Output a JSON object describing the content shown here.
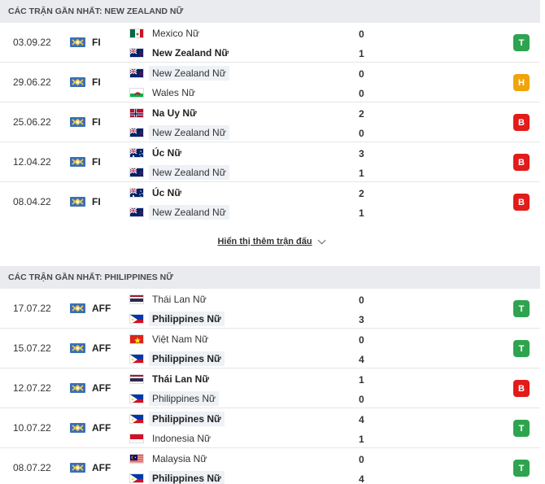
{
  "sections": [
    {
      "title": "CÁC TRẬN GẦN NHẤT: NEW ZEALAND NỮ",
      "matches": [
        {
          "date": "03.09.22",
          "league": "FI",
          "home": {
            "name": "Mexico Nữ",
            "flag": "mx",
            "bold": false,
            "hl": false
          },
          "home_score": "0",
          "away": {
            "name": "New Zealand Nữ",
            "flag": "nz",
            "bold": true,
            "hl": false
          },
          "away_score": "1",
          "result": "T",
          "result_color": "#2ea44f"
        },
        {
          "date": "29.06.22",
          "league": "FI",
          "home": {
            "name": "New Zealand Nữ",
            "flag": "nz",
            "bold": false,
            "hl": true
          },
          "home_score": "0",
          "away": {
            "name": "Wales Nữ",
            "flag": "wales",
            "bold": false,
            "hl": false
          },
          "away_score": "0",
          "result": "H",
          "result_color": "#f0a30a"
        },
        {
          "date": "25.06.22",
          "league": "FI",
          "home": {
            "name": "Na Uy Nữ",
            "flag": "no",
            "bold": true,
            "hl": false
          },
          "home_score": "2",
          "away": {
            "name": "New Zealand Nữ",
            "flag": "nz",
            "bold": false,
            "hl": true
          },
          "away_score": "0",
          "result": "B",
          "result_color": "#e21b1b"
        },
        {
          "date": "12.04.22",
          "league": "FI",
          "home": {
            "name": "Úc Nữ",
            "flag": "au",
            "bold": true,
            "hl": false
          },
          "home_score": "3",
          "away": {
            "name": "New Zealand Nữ",
            "flag": "nz",
            "bold": false,
            "hl": true
          },
          "away_score": "1",
          "result": "B",
          "result_color": "#e21b1b"
        },
        {
          "date": "08.04.22",
          "league": "FI",
          "home": {
            "name": "Úc Nữ",
            "flag": "au",
            "bold": true,
            "hl": false
          },
          "home_score": "2",
          "away": {
            "name": "New Zealand Nữ",
            "flag": "nz",
            "bold": false,
            "hl": true
          },
          "away_score": "1",
          "result": "B",
          "result_color": "#e21b1b"
        }
      ],
      "more_label": "Hiển thị thêm trận đấu"
    },
    {
      "title": "CÁC TRẬN GẦN NHẤT: PHILIPPINES NỮ",
      "matches": [
        {
          "date": "17.07.22",
          "league": "AFF",
          "home": {
            "name": "Thái Lan Nữ",
            "flag": "th",
            "bold": false,
            "hl": false
          },
          "home_score": "0",
          "away": {
            "name": "Philippines Nữ",
            "flag": "ph",
            "bold": true,
            "hl": true
          },
          "away_score": "3",
          "result": "T",
          "result_color": "#2ea44f"
        },
        {
          "date": "15.07.22",
          "league": "AFF",
          "home": {
            "name": "Việt Nam Nữ",
            "flag": "vn",
            "bold": false,
            "hl": false
          },
          "home_score": "0",
          "away": {
            "name": "Philippines Nữ",
            "flag": "ph",
            "bold": true,
            "hl": true
          },
          "away_score": "4",
          "result": "T",
          "result_color": "#2ea44f"
        },
        {
          "date": "12.07.22",
          "league": "AFF",
          "home": {
            "name": "Thái Lan Nữ",
            "flag": "th",
            "bold": true,
            "hl": false
          },
          "home_score": "1",
          "away": {
            "name": "Philippines Nữ",
            "flag": "ph",
            "bold": false,
            "hl": true
          },
          "away_score": "0",
          "result": "B",
          "result_color": "#e21b1b"
        },
        {
          "date": "10.07.22",
          "league": "AFF",
          "home": {
            "name": "Philippines Nữ",
            "flag": "ph",
            "bold": true,
            "hl": true
          },
          "home_score": "4",
          "away": {
            "name": "Indonesia Nữ",
            "flag": "id",
            "bold": false,
            "hl": false
          },
          "away_score": "1",
          "result": "T",
          "result_color": "#2ea44f"
        },
        {
          "date": "08.07.22",
          "league": "AFF",
          "home": {
            "name": "Malaysia Nữ",
            "flag": "my",
            "bold": false,
            "hl": false
          },
          "home_score": "0",
          "away": {
            "name": "Philippines Nữ",
            "flag": "ph",
            "bold": true,
            "hl": true
          },
          "away_score": "4",
          "result": "T",
          "result_color": "#2ea44f"
        }
      ]
    }
  ],
  "league_icon": "trophy-flag-icon"
}
